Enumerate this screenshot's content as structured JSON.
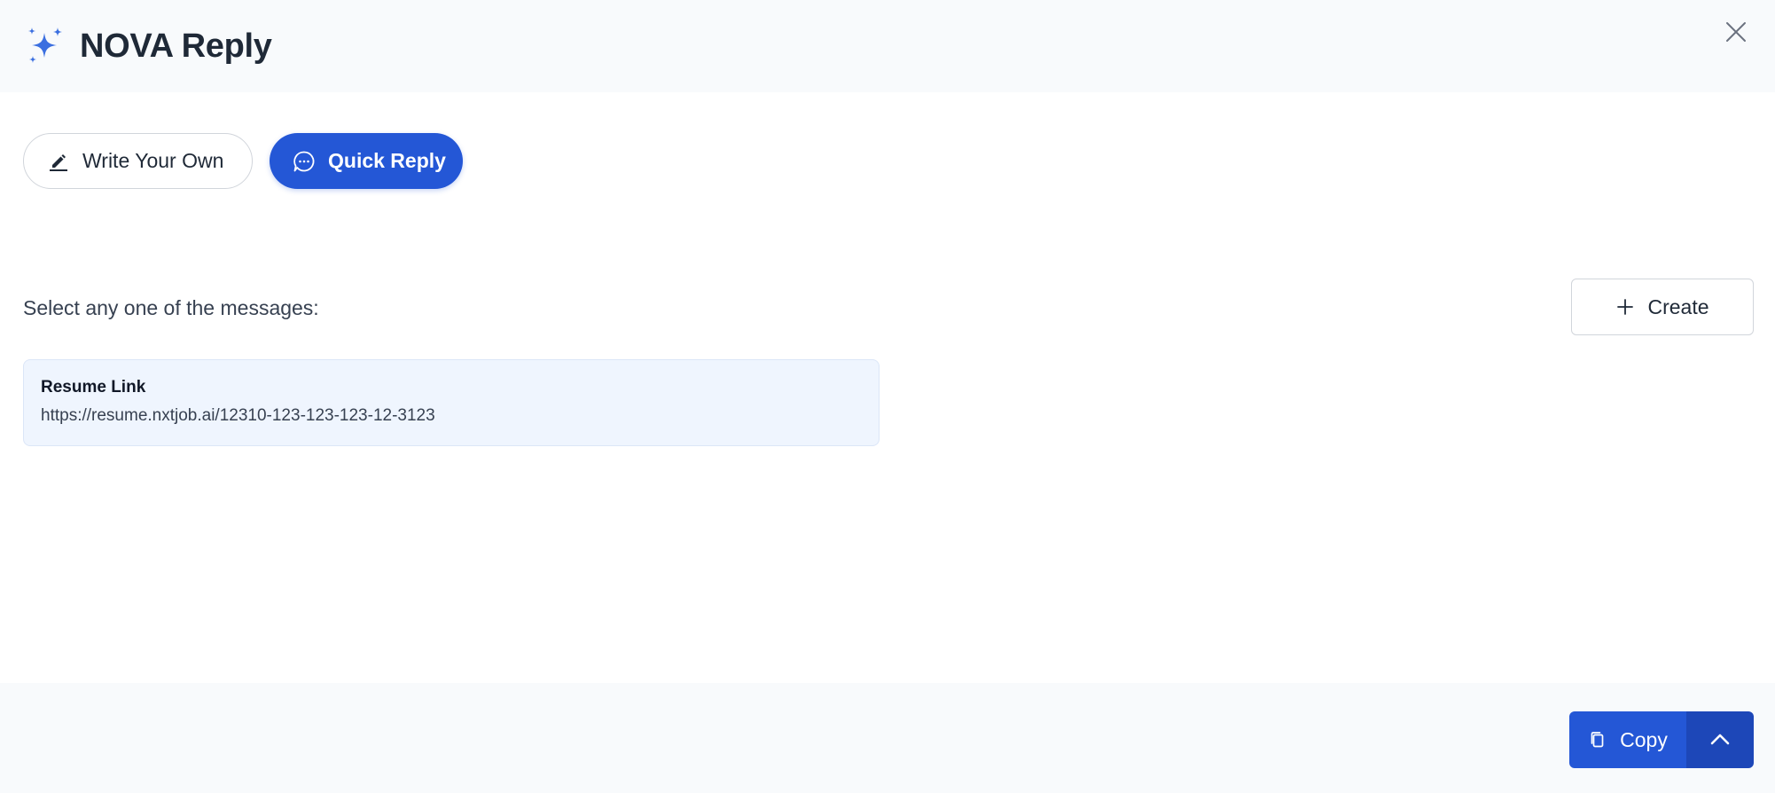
{
  "header": {
    "title": "NOVA Reply",
    "icon": "sparkles-icon",
    "close_icon": "close-icon"
  },
  "tabs": [
    {
      "label": "Write Your Own",
      "icon": "pencil-icon",
      "active": false
    },
    {
      "label": "Quick Reply",
      "icon": "chat-bubble-icon",
      "active": true
    }
  ],
  "main": {
    "prompt": "Select any one of the messages:",
    "create_label": "Create",
    "messages": [
      {
        "title": "Resume Link",
        "text": "https://resume.nxtjob.ai/12310-123-123-123-12-3123"
      }
    ]
  },
  "footer": {
    "copy_label": "Copy",
    "copy_icon": "copy-icon",
    "expand_icon": "chevron-up-icon"
  },
  "colors": {
    "accent": "#2457d6",
    "accent_dark": "#1d47b8",
    "sparkle": "#3b6fe0",
    "header_bg": "#f8fafc",
    "card_bg": "#eff5fe"
  }
}
